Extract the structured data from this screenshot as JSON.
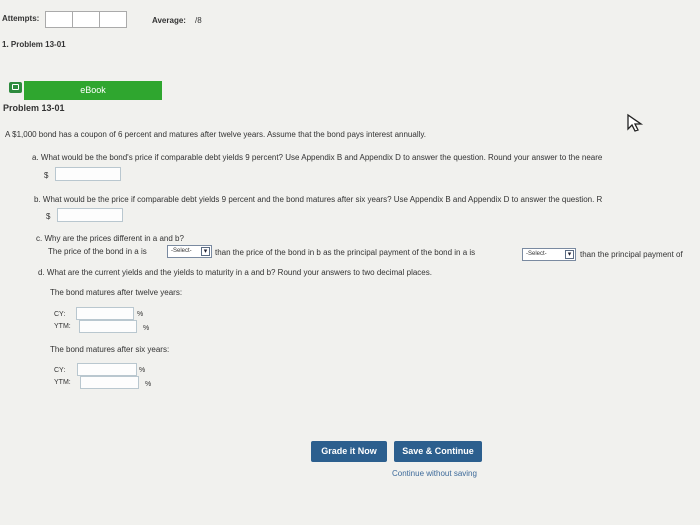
{
  "header": {
    "attempts_label": "Attempts:",
    "average_label": "Average:",
    "average_value": "/8",
    "problem_nav": "1. Problem 13-01"
  },
  "ebook": {
    "label": "eBook"
  },
  "problem": {
    "title": "Problem 13-01",
    "intro": "A $1,000 bond has a coupon of 6 percent and matures after twelve years. Assume that the bond pays interest annually.",
    "part_a": "a. What would be the bond's price if comparable debt yields 9 percent? Use Appendix B and Appendix D to answer the question. Round your answer to the neare",
    "part_b": "b. What would be the price if comparable debt yields 9 percent and the bond matures after six years? Use Appendix B and Appendix D to answer the question. R",
    "currency_symbol": "$",
    "part_c_question": "c. Why are the prices different in a and b?",
    "part_c_s1": "The price of the bond in a is",
    "part_c_s2": "than the price of the bond in b as the principal payment of the bond in a is",
    "part_c_s3": "than the principal payment of",
    "select_placeholder": "-Select-",
    "part_d": "d. What are the current yields and the yields to maturity in a and b? Round your answers to two decimal places.",
    "twelve_label": "The bond matures after twelve years:",
    "six_label": "The bond matures after six years:",
    "cy_label": "CY:",
    "ytm_label": "YTM:",
    "percent": "%"
  },
  "actions": {
    "grade": "Grade it Now",
    "save": "Save & Continue",
    "continue": "Continue without saving"
  }
}
